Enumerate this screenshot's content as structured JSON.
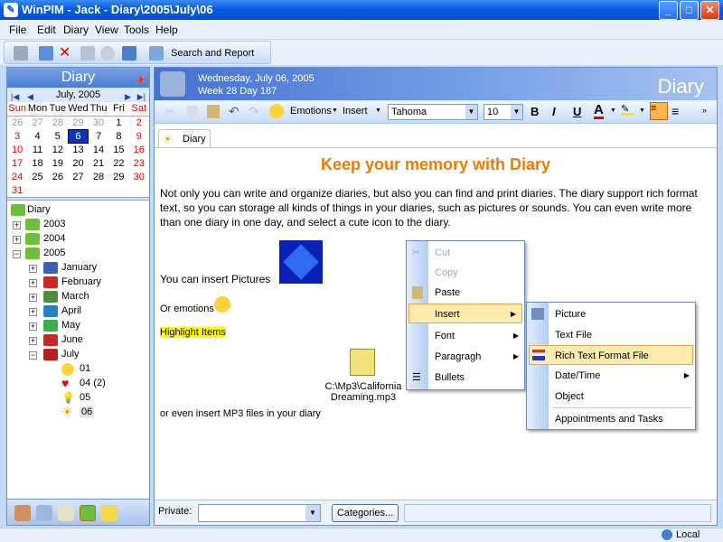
{
  "window": {
    "title": "WinPIM - Jack - Diary\\2005\\July\\06",
    "min": "_",
    "max": "□",
    "close": "✕"
  },
  "menu": [
    "File",
    "Edit",
    "Diary",
    "View",
    "Tools",
    "Help"
  ],
  "toolbar": {
    "search_label": "Search and Report"
  },
  "left": {
    "header": "Diary",
    "calendar": {
      "month": "July, 2005",
      "days": [
        "Sun",
        "Mon",
        "Tue",
        "Wed",
        "Thu",
        "Fri",
        "Sat"
      ],
      "weeks": [
        [
          "26",
          "27",
          "28",
          "29",
          "30",
          "1",
          "2"
        ],
        [
          "3",
          "4",
          "5",
          "6",
          "7",
          "8",
          "9"
        ],
        [
          "10",
          "11",
          "12",
          "13",
          "14",
          "15",
          "16"
        ],
        [
          "17",
          "18",
          "19",
          "20",
          "21",
          "22",
          "23"
        ],
        [
          "24",
          "25",
          "26",
          "27",
          "28",
          "29",
          "30"
        ],
        [
          "31",
          "",
          "",
          "",
          "",
          "",
          ""
        ]
      ]
    },
    "tree": {
      "root": "Diary",
      "years": [
        "2003",
        "2004",
        "2005"
      ],
      "months": [
        "January",
        "February",
        "March",
        "April",
        "May",
        "June",
        "July"
      ],
      "days": [
        "01",
        "04 (2)",
        "05",
        "06"
      ]
    }
  },
  "diary": {
    "date": "Wednesday, July 06, 2005",
    "week": "Week 28  Day 187",
    "title": "Diary"
  },
  "format": {
    "emotions": "Emotions",
    "insert": "Insert",
    "font": "Tahoma",
    "size": "10",
    "bold": "B",
    "italic": "I",
    "underline": "U",
    "fontcolor": "A"
  },
  "tab": "Diary",
  "content": {
    "heading": "Keep your memory with Diary",
    "paragraph": "Not only you can write and organize diaries, but also you can find and print diaries. The diary support rich format text, so you can storage all kinds of things in your diaries, such as pictures or sounds. You can even write more than one diary in one day, and select a cute icon to the diary.",
    "pictures": "You can insert Pictures",
    "emotions": "Or emotions",
    "highlight": "Highlight Items",
    "file_caption_1": "C:\\Mp3\\California",
    "file_caption_2": "Dreaming.mp3",
    "mp3": "or even insert MP3 files in your diary"
  },
  "context_menu": [
    "Cut",
    "Copy",
    "Paste",
    "Insert",
    "Font",
    "Paragragh",
    "Bullets"
  ],
  "insert_submenu": [
    "Picture",
    "Text File",
    "Rich Text Format File",
    "Date/Time",
    "Object",
    "Appointments and Tasks"
  ],
  "bottom": {
    "private": "Private:",
    "categories": "Categories..."
  },
  "status": {
    "local": "Local"
  },
  "colors": {
    "heading": "#f07a00",
    "highlight": "#ffff00",
    "accent": "#0a35b8"
  }
}
